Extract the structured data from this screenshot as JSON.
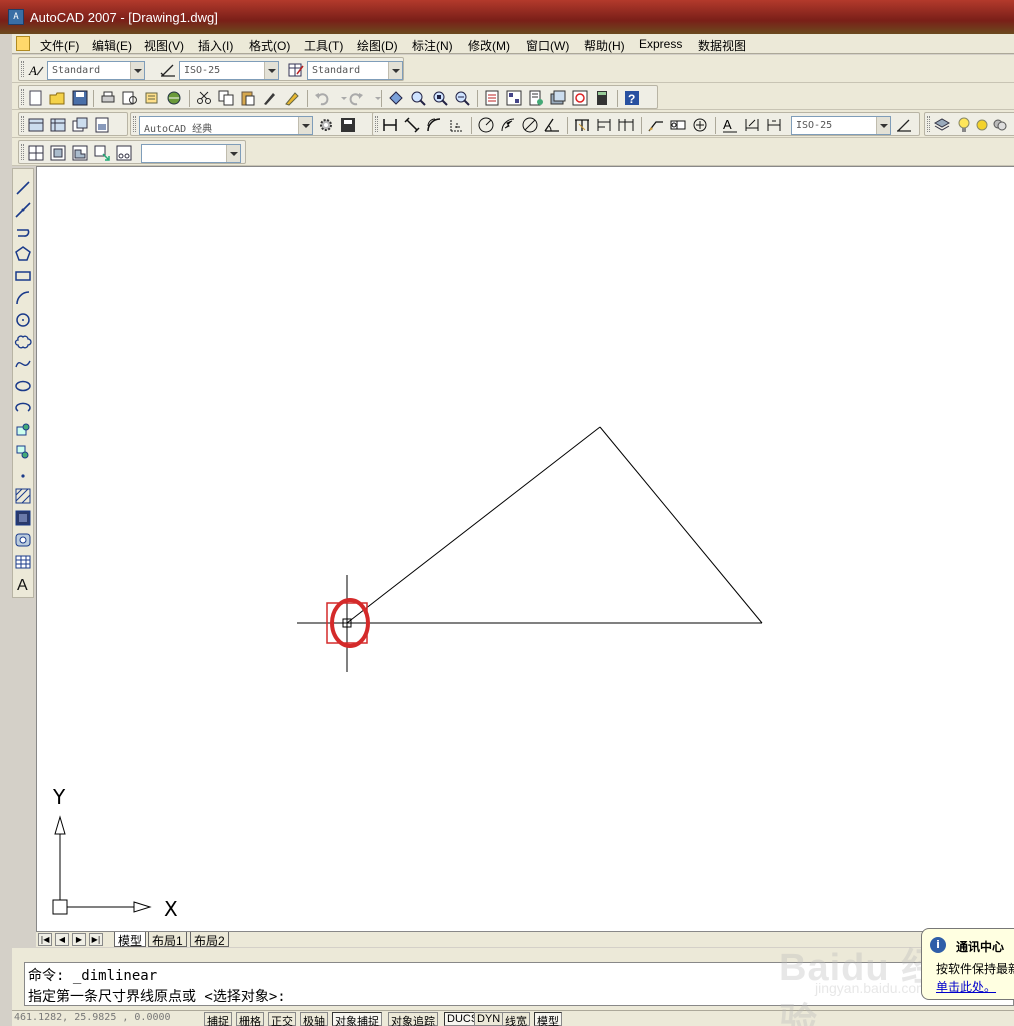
{
  "window": {
    "title": "AutoCAD 2007 - [Drawing1.dwg]"
  },
  "menu": [
    "文件(F)",
    "编辑(E)",
    "视图(V)",
    "插入(I)",
    "格式(O)",
    "工具(T)",
    "绘图(D)",
    "标注(N)",
    "修改(M)",
    "窗口(W)",
    "帮助(H)",
    "Express",
    "数据视图"
  ],
  "styles_toolbar": {
    "text_style": "Standard",
    "dim_style": "ISO-25",
    "table_style": "Standard"
  },
  "workspace_toolbar": {
    "workspace": "AutoCAD 经典",
    "dim_style": "ISO-25"
  },
  "layer_toolbar": {
    "layer_value": ""
  },
  "left_tools": [
    "line-icon",
    "construction-line-icon",
    "polyline-icon",
    "polygon-icon",
    "rectangle-icon",
    "arc-icon",
    "circle-icon",
    "revision-cloud-icon",
    "spline-icon",
    "ellipse-icon",
    "ellipse-arc-icon",
    "insert-block-icon",
    "make-block-icon",
    "point-icon",
    "hatch-icon",
    "gradient-icon",
    "region-icon",
    "table-icon",
    "multiline-text-icon"
  ],
  "ucs": {
    "x_label": "X",
    "y_label": "Y"
  },
  "layout_tabs": [
    {
      "label": "模型",
      "active": true
    },
    {
      "label": "布局1",
      "active": false
    },
    {
      "label": "布局2",
      "active": false
    }
  ],
  "command": {
    "line1": "命令: _dimlinear",
    "line2": "指定第一条尺寸界线原点或 <选择对象>:"
  },
  "status": {
    "coords": "461.1282, 25.9825 , 0.0000",
    "buttons": [
      {
        "label": "捕捉",
        "on": false
      },
      {
        "label": "栅格",
        "on": false
      },
      {
        "label": "正交",
        "on": false
      },
      {
        "label": "极轴",
        "on": false
      },
      {
        "label": "对象捕捉",
        "on": true
      },
      {
        "label": "对象追踪",
        "on": false
      },
      {
        "label": "DUCS",
        "on": true
      },
      {
        "label": "DYN",
        "on": false
      },
      {
        "label": "线宽",
        "on": false
      },
      {
        "label": "模型",
        "on": true
      }
    ]
  },
  "balloon": {
    "title": "通讯中心",
    "body": "按软件保持最新",
    "link": "单击此处。"
  },
  "watermark": {
    "main": "Baidu 经验",
    "sub": "jingyan.baidu.com"
  },
  "colors": {
    "marker": "#d42a2a",
    "titlebar": "#8a2a20",
    "face": "#ece9d8"
  }
}
